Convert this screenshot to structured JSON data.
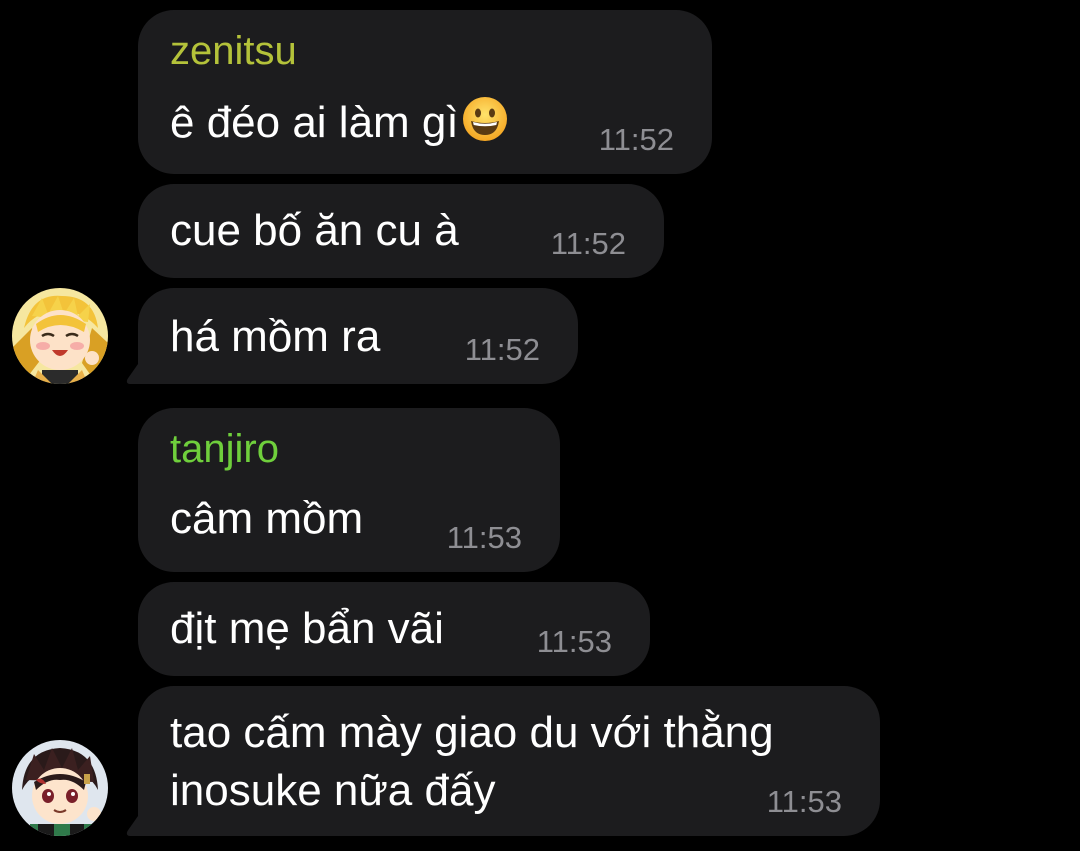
{
  "messages": [
    {
      "sender": "zenitsu",
      "sender_color": "#b4c23a",
      "text": "ê đéo ai làm gì",
      "emoji": "grinning-face-emoji",
      "time": "11:52"
    },
    {
      "text": "cue bố ăn cu à",
      "time": "11:52"
    },
    {
      "text": "há mồm ra",
      "time": "11:52",
      "avatar": "zenitsu-avatar"
    },
    {
      "sender": "tanjiro",
      "sender_color": "#6fcf3c",
      "text": "câm mồm",
      "time": "11:53"
    },
    {
      "text": "địt mẹ bẩn vãi",
      "time": "11:53"
    },
    {
      "text": "tao cấm mày giao du với thằng\ninosuke nữa đấy",
      "time": "11:53",
      "avatar": "tanjiro-avatar"
    }
  ],
  "theme": {
    "background": "#000000",
    "bubble": "#1c1c1e",
    "timestamp": "#8e8e93",
    "text": "#ffffff"
  }
}
